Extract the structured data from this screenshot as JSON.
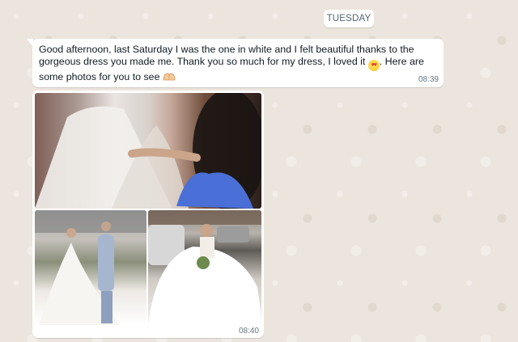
{
  "chat": {
    "day_label": "TUESDAY",
    "messages": [
      {
        "text_part1": "Good afternoon, last Saturday I was the one in white and I felt beautiful thanks to the gorgeous dress you made me. Thank you so much for my dress, I loved it ",
        "emoji1": "heart-eyes-emoji",
        "text_part2": ". Here are some photos for you to see ",
        "emoji2": "heart-hands-emoji",
        "time": "08:39"
      },
      {
        "photos": [
          {
            "name": "wedding-dress-back-photo"
          },
          {
            "name": "bride-and-groom-photo"
          },
          {
            "name": "bride-sitting-in-street-photo"
          }
        ],
        "time": "08:40"
      }
    ]
  },
  "colors": {
    "chat_background": "#efeae2",
    "bubble": "#ffffff",
    "text": "#111b21",
    "meta": "#667781"
  }
}
